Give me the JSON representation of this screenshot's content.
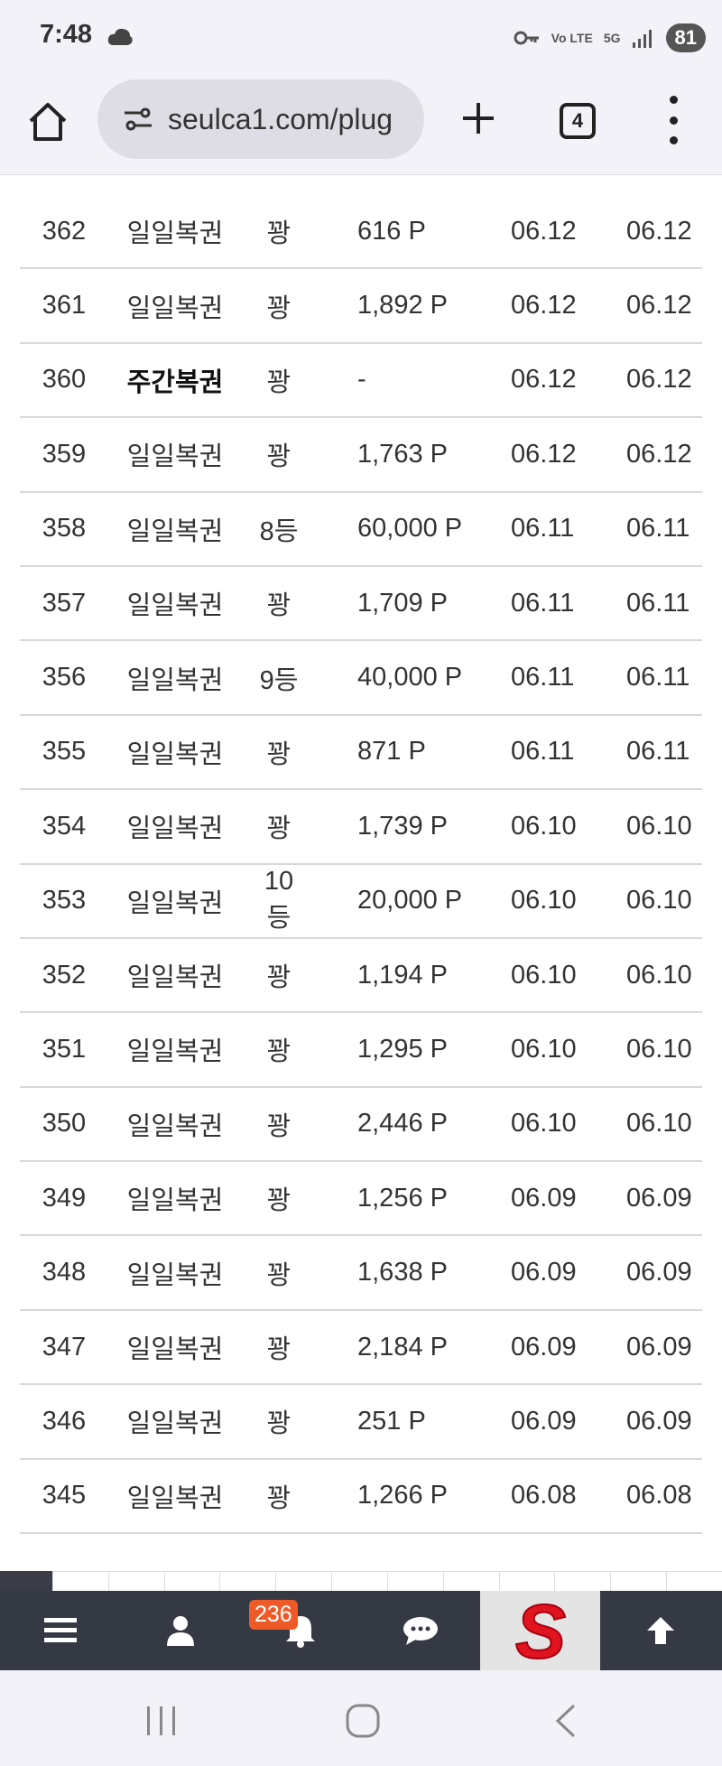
{
  "status_bar": {
    "time": "7:48",
    "network": "5G",
    "lte": "Vo LTE",
    "battery": "81"
  },
  "browser": {
    "url": "seulca1.com/plug",
    "tab_count": "4"
  },
  "table": {
    "rows": [
      {
        "no": "362",
        "name": "일일복권",
        "rank": "꽝",
        "prize": "616 P",
        "date1": "06.12",
        "date2": "06.12",
        "bold": false
      },
      {
        "no": "361",
        "name": "일일복권",
        "rank": "꽝",
        "prize": "1,892 P",
        "date1": "06.12",
        "date2": "06.12",
        "bold": false
      },
      {
        "no": "360",
        "name": "주간복권",
        "rank": "꽝",
        "prize": "-",
        "date1": "06.12",
        "date2": "06.12",
        "bold": true
      },
      {
        "no": "359",
        "name": "일일복권",
        "rank": "꽝",
        "prize": "1,763 P",
        "date1": "06.12",
        "date2": "06.12",
        "bold": false
      },
      {
        "no": "358",
        "name": "일일복권",
        "rank": "8등",
        "prize": "60,000 P",
        "date1": "06.11",
        "date2": "06.11",
        "bold": false
      },
      {
        "no": "357",
        "name": "일일복권",
        "rank": "꽝",
        "prize": "1,709 P",
        "date1": "06.11",
        "date2": "06.11",
        "bold": false
      },
      {
        "no": "356",
        "name": "일일복권",
        "rank": "9등",
        "prize": "40,000 P",
        "date1": "06.11",
        "date2": "06.11",
        "bold": false
      },
      {
        "no": "355",
        "name": "일일복권",
        "rank": "꽝",
        "prize": "871 P",
        "date1": "06.11",
        "date2": "06.11",
        "bold": false
      },
      {
        "no": "354",
        "name": "일일복권",
        "rank": "꽝",
        "prize": "1,739 P",
        "date1": "06.10",
        "date2": "06.10",
        "bold": false
      },
      {
        "no": "353",
        "name": "일일복권",
        "rank": "10등",
        "prize": "20,000 P",
        "date1": "06.10",
        "date2": "06.10",
        "bold": false
      },
      {
        "no": "352",
        "name": "일일복권",
        "rank": "꽝",
        "prize": "1,194 P",
        "date1": "06.10",
        "date2": "06.10",
        "bold": false
      },
      {
        "no": "351",
        "name": "일일복권",
        "rank": "꽝",
        "prize": "1,295 P",
        "date1": "06.10",
        "date2": "06.10",
        "bold": false
      },
      {
        "no": "350",
        "name": "일일복권",
        "rank": "꽝",
        "prize": "2,446 P",
        "date1": "06.10",
        "date2": "06.10",
        "bold": false
      },
      {
        "no": "349",
        "name": "일일복권",
        "rank": "꽝",
        "prize": "1,256 P",
        "date1": "06.09",
        "date2": "06.09",
        "bold": false
      },
      {
        "no": "348",
        "name": "일일복권",
        "rank": "꽝",
        "prize": "1,638 P",
        "date1": "06.09",
        "date2": "06.09",
        "bold": false
      },
      {
        "no": "347",
        "name": "일일복권",
        "rank": "꽝",
        "prize": "2,184 P",
        "date1": "06.09",
        "date2": "06.09",
        "bold": false
      },
      {
        "no": "346",
        "name": "일일복권",
        "rank": "꽝",
        "prize": "251 P",
        "date1": "06.09",
        "date2": "06.09",
        "bold": false
      },
      {
        "no": "345",
        "name": "일일복권",
        "rank": "꽝",
        "prize": "1,266 P",
        "date1": "06.08",
        "date2": "06.08",
        "bold": false
      }
    ]
  },
  "bottom_nav": {
    "notification_count": "236",
    "items": [
      "menu-icon",
      "user-icon",
      "bell-icon",
      "chat-icon",
      "site-logo",
      "arrow-up-icon"
    ],
    "logo_letter": "S",
    "logo_color": "#e0141e"
  },
  "android_nav": [
    "recents-icon",
    "home-icon",
    "back-icon"
  ]
}
